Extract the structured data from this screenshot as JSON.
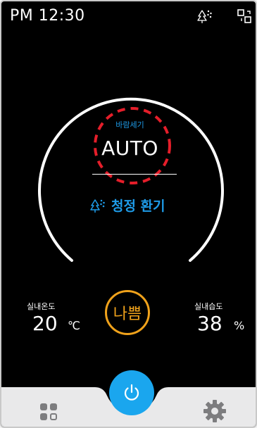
{
  "status_bar": {
    "time": "PM 12:30",
    "icons": [
      "fan-tree-icon",
      "device-link-icon"
    ]
  },
  "fan": {
    "label": "바람세기",
    "value": "AUTO"
  },
  "mode": {
    "label": "청정 환기",
    "icon": "fan-tree-icon"
  },
  "indoor_temp": {
    "label": "실내온도",
    "value": "20",
    "unit": "℃"
  },
  "indoor_humidity": {
    "label": "실내습도",
    "value": "38",
    "unit": "%"
  },
  "air_quality": {
    "value": "나쁨"
  },
  "bottom_nav": {
    "icons": [
      "menu-grid-icon",
      "power-icon",
      "settings-gear-icon"
    ]
  },
  "colors": {
    "background": "#000000",
    "accent": "#1e9be8",
    "power_button": "#1aa6ee",
    "air_quality_bad": "#f0a21b",
    "highlight_ring": "#e51e2a",
    "nav_bar": "#e9e9ea"
  }
}
